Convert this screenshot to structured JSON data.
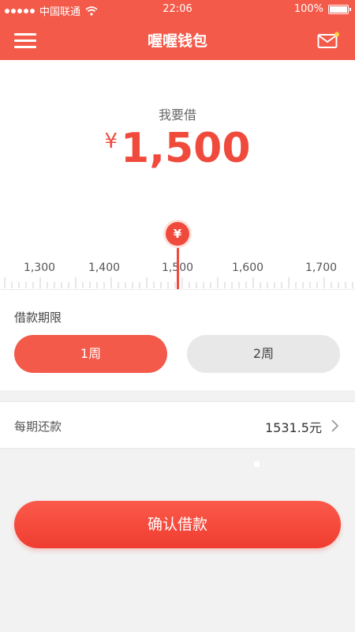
{
  "status_bar": {
    "carrier": "中国联通",
    "time": "22:06",
    "battery": "100%"
  },
  "nav": {
    "title": "喔喔钱包",
    "menu_icon": "hamburger-menu-icon",
    "mail_icon": "mail-icon"
  },
  "loan": {
    "label": "我要借",
    "currency_symbol": "¥",
    "amount": "1,500",
    "slider": {
      "marker_symbol": "¥",
      "ticks": [
        "1,300",
        "1,400",
        "1,500",
        "1,600",
        "1,700"
      ]
    }
  },
  "term": {
    "label": "借款期限",
    "options": [
      "1周",
      "2周"
    ],
    "selected": "1周"
  },
  "repayment": {
    "label": "每期还款",
    "value": "1531.5元"
  },
  "confirm_button": {
    "label": "确认借款"
  },
  "colors": {
    "brand": "#f35a4a",
    "accent": "#f04a3c",
    "inactive": "#e8e8e8"
  }
}
